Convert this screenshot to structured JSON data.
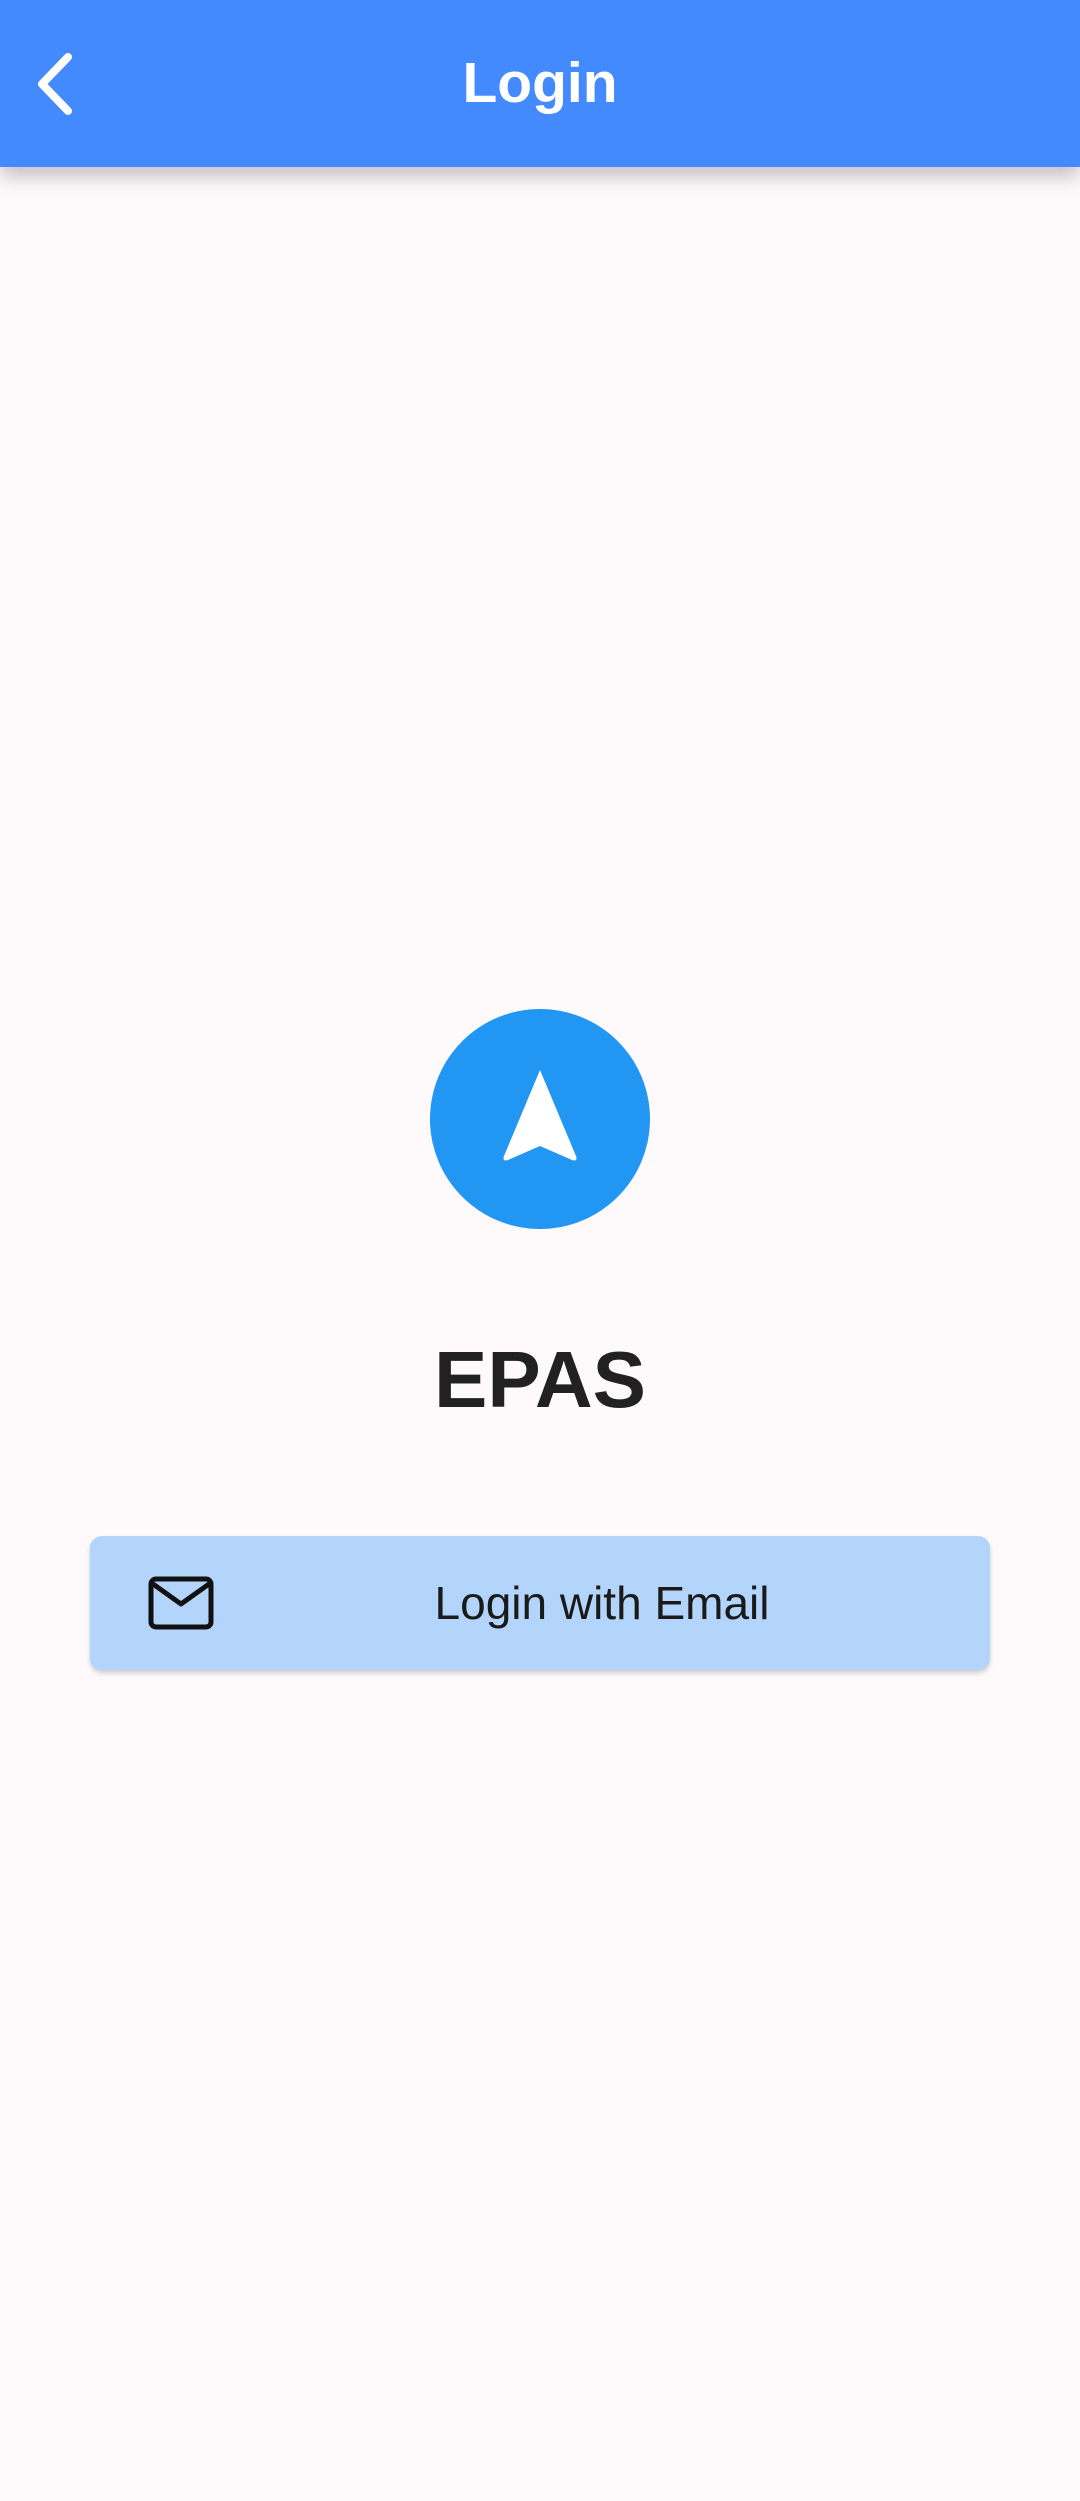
{
  "app_bar": {
    "title": "Login",
    "back_icon": "chevron-left-icon",
    "background_color": "#448aff"
  },
  "logo": {
    "icon": "navigation-arrow-icon",
    "circle_color": "#2196f3"
  },
  "app_name": "EPAS",
  "login_button": {
    "icon": "mail-icon",
    "label": "Login with Email",
    "background_color": "#b3d5fb"
  },
  "colors": {
    "page_background": "#fefafc",
    "primary": "#448aff",
    "accent": "#2196f3"
  }
}
